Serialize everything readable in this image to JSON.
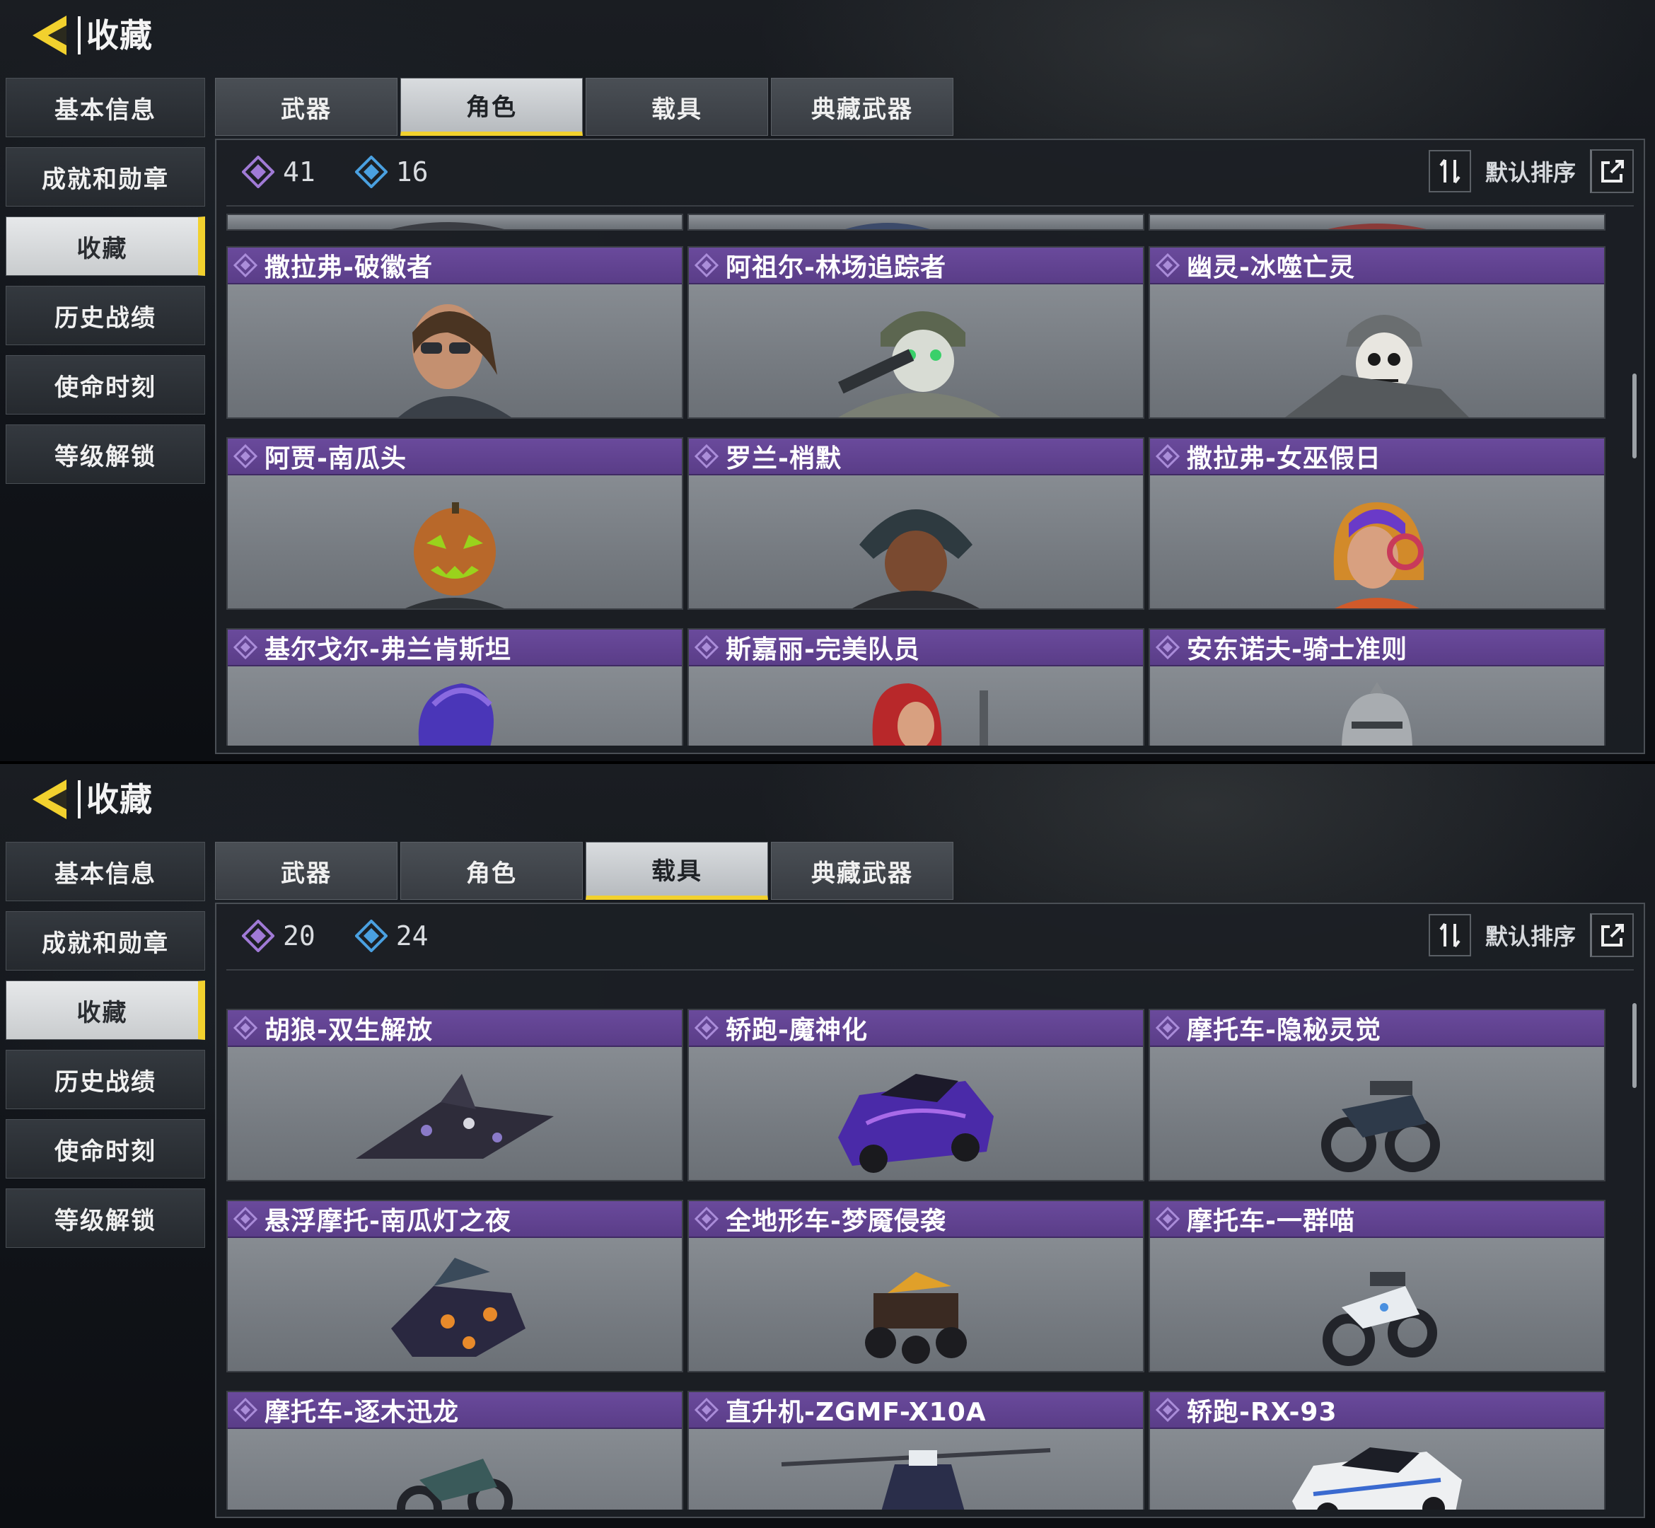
{
  "header": {
    "title": "收藏",
    "back_icon": "back-arrow-icon",
    "accent": "#f2d12e"
  },
  "sidebar": {
    "items": [
      {
        "label": "基本信息"
      },
      {
        "label": "成就和勋章"
      },
      {
        "label": "收藏"
      },
      {
        "label": "历史战绩"
      },
      {
        "label": "使命时刻"
      },
      {
        "label": "等级解锁"
      }
    ]
  },
  "tabs": [
    {
      "label": "武器"
    },
    {
      "label": "角色"
    },
    {
      "label": "载具"
    },
    {
      "label": "典藏武器"
    }
  ],
  "toolbar": {
    "sort_label": "默认排序",
    "sort_icon": "sort-arrows-icon",
    "share_icon": "share-icon"
  },
  "colors": {
    "rarity_purple": "#6a4a9c",
    "card_grey": "#8f949a",
    "active_yellow": "#f2d12e"
  },
  "views": [
    {
      "active_tab": "角色",
      "stats": {
        "legendary": "41",
        "epic": "16"
      },
      "cards": [
        {
          "title": "撒拉弗-破徽者"
        },
        {
          "title": "阿祖尔-林场追踪者"
        },
        {
          "title": "幽灵-冰噬亡灵"
        },
        {
          "title": "阿贾-南瓜头"
        },
        {
          "title": "罗兰-梢默"
        },
        {
          "title": "撒拉弗-女巫假日"
        },
        {
          "title": "基尔戈尔-弗兰肯斯坦"
        },
        {
          "title": "斯嘉丽-完美队员"
        },
        {
          "title": "安东诺夫-骑士准则"
        }
      ]
    },
    {
      "active_tab": "载具",
      "stats": {
        "legendary": "20",
        "epic": "24"
      },
      "cards": [
        {
          "title": "胡狼-双生解放"
        },
        {
          "title": "轿跑-魔神化"
        },
        {
          "title": "摩托车-隐秘灵觉"
        },
        {
          "title": "悬浮摩托-南瓜灯之夜"
        },
        {
          "title": "全地形车-梦魇侵袭"
        },
        {
          "title": "摩托车-一群喵"
        },
        {
          "title": "摩托车-逐木迅龙"
        },
        {
          "title": "直升机-ZGMF-X10A"
        },
        {
          "title": "轿跑-RX-93"
        }
      ]
    }
  ]
}
